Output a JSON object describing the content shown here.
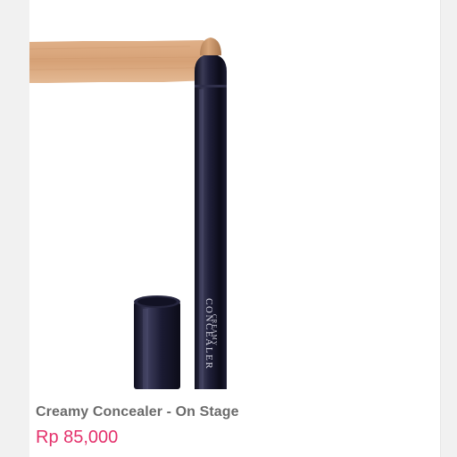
{
  "product": {
    "name": "Creamy Concealer - On Stage",
    "price": "Rp 85,000",
    "image": {
      "label_line1": "CREAMY",
      "label_line2": "CONCEALER"
    }
  },
  "colors": {
    "price": "#e4306b",
    "name": "#6b6b6b",
    "swatch": "#d9a77c",
    "pen_body": "#1a1a2e",
    "background": "#f1f1f1"
  }
}
